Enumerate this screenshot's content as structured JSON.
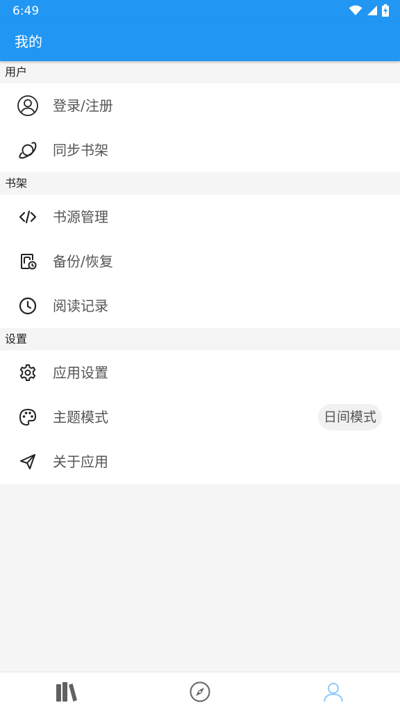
{
  "status_bar": {
    "time": "6:49",
    "background": "#2196f3",
    "icons": [
      "wifi-icon",
      "cell-signal-icon",
      "battery-charging-icon"
    ]
  },
  "app_bar": {
    "title": "我的"
  },
  "sections": {
    "user": {
      "header": "用户",
      "items": [
        {
          "label": "登录/注册",
          "icon": "user-circle-icon"
        },
        {
          "label": "同步书架",
          "icon": "planet-icon"
        }
      ]
    },
    "bookshelf": {
      "header": "书架",
      "items": [
        {
          "label": "书源管理",
          "icon": "code-icon"
        },
        {
          "label": "备份/恢复",
          "icon": "backup-icon"
        },
        {
          "label": "阅读记录",
          "icon": "clock-icon"
        }
      ]
    },
    "settings": {
      "header": "设置",
      "items": [
        {
          "label": "应用设置",
          "icon": "gear-icon"
        },
        {
          "label": "主题模式",
          "icon": "palette-icon",
          "value": "日间模式"
        },
        {
          "label": "关于应用",
          "icon": "send-icon"
        }
      ]
    }
  },
  "bottom_nav": {
    "items": [
      {
        "icon": "bookshelf-icon",
        "active": false
      },
      {
        "icon": "compass-icon",
        "active": false
      },
      {
        "icon": "profile-icon",
        "active": true
      }
    ],
    "active_color": "#90caf9",
    "inactive_color": "#616161"
  }
}
